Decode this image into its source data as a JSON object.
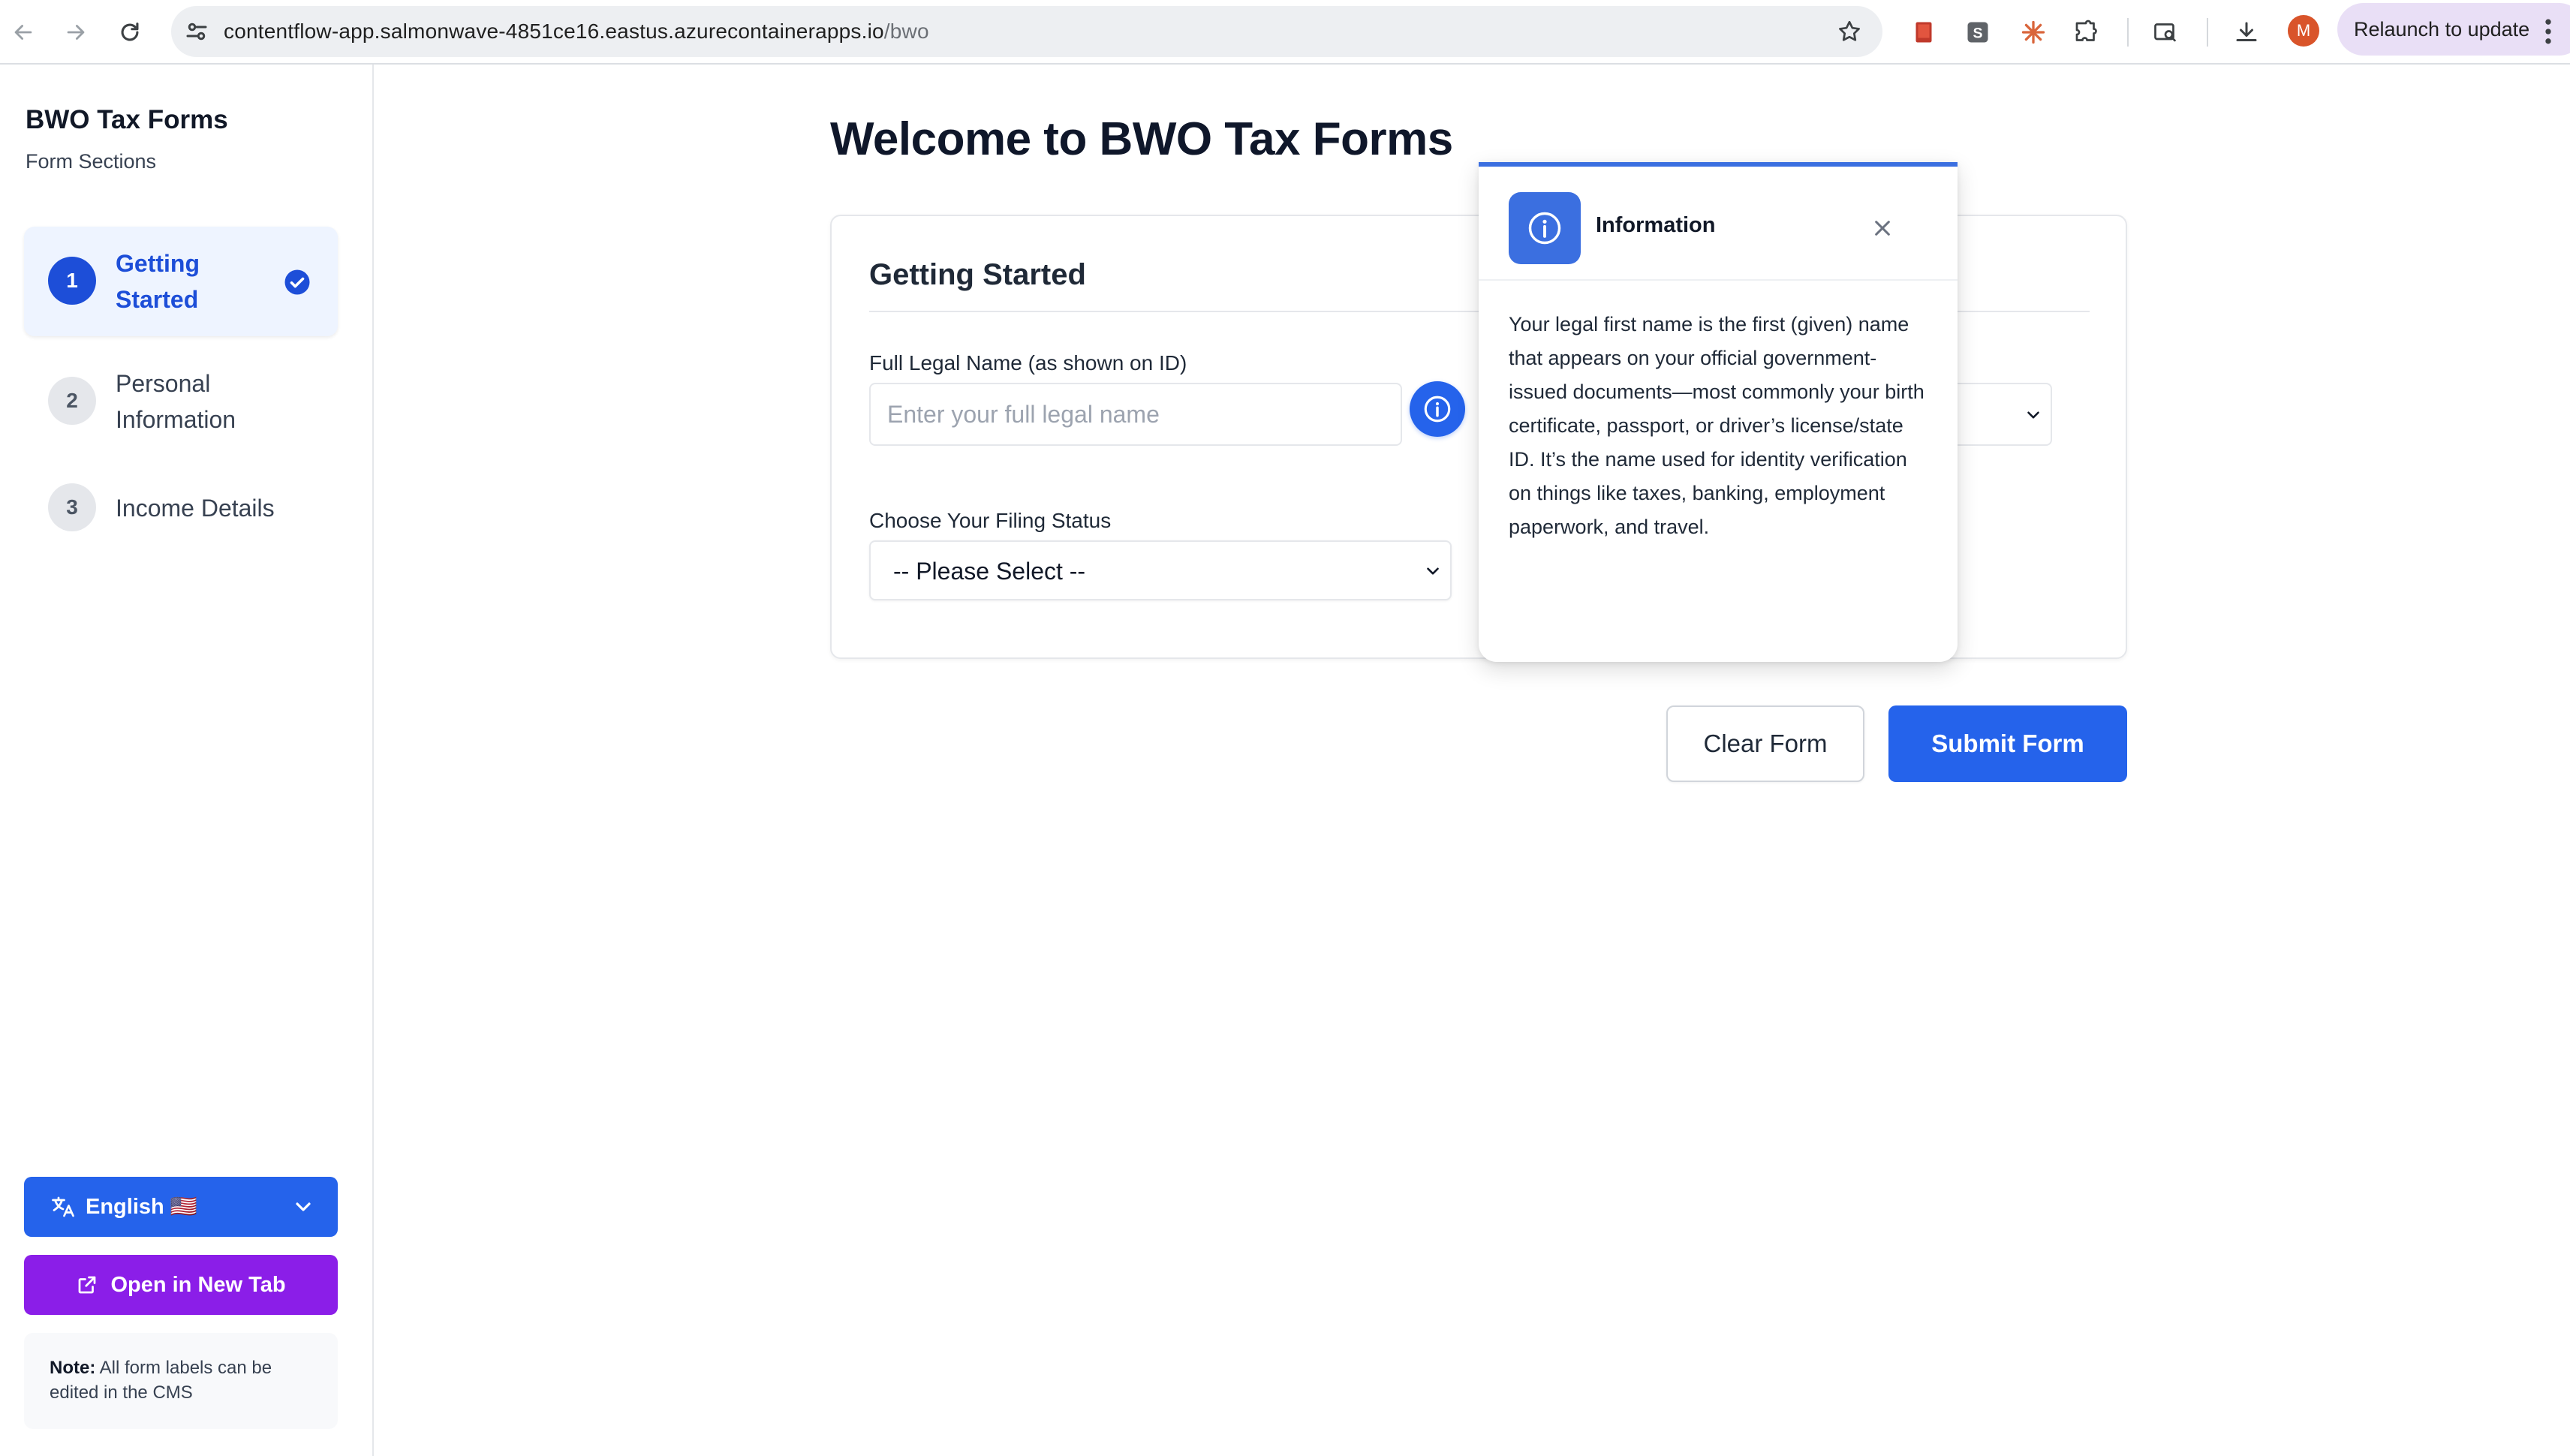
{
  "browser": {
    "url_host": "contentflow-app.salmonwave-4851ce16.eastus.azurecontainerapps.io",
    "url_path": "/bwo",
    "profile_initial": "M",
    "relaunch_label": "Relaunch to update"
  },
  "sidebar": {
    "title": "BWO Tax Forms",
    "subtitle": "Form Sections",
    "steps": [
      {
        "number": "1",
        "label": "Getting Started",
        "state": "active-complete"
      },
      {
        "number": "2",
        "label": "Personal Information",
        "state": "pending"
      },
      {
        "number": "3",
        "label": "Income Details",
        "state": "pending"
      }
    ],
    "language_label": "English 🇺🇸",
    "open_new_tab_label": "Open in New Tab",
    "note_bold": "Note:",
    "note_text": " All form labels can be edited in the CMS"
  },
  "main": {
    "page_title": "Welcome to BWO Tax Forms",
    "section_title": "Getting Started",
    "name_label": "Full Legal Name (as shown on ID)",
    "name_placeholder": "Enter your full legal name",
    "name_value": "",
    "filing_label": "Choose Your Filing Status",
    "filing_value": "-- Please Select --",
    "clear_label": "Clear Form",
    "submit_label": "Submit Form"
  },
  "popover": {
    "title": "Information",
    "body": "Your legal first name is the first (given) name that appears on your official government-issued documents—most commonly your birth certificate, passport, or driver’s license/state ID. It’s the name used for identity verification on things like taxes, banking, employment paperwork, and travel."
  },
  "colors": {
    "accent": "#2563eb",
    "purple_button": "#8b1ee8",
    "popover_icon": "#3b6fe0"
  },
  "icons": {
    "step_complete": "check-circle-icon",
    "info": "info-icon",
    "language": "translate-icon",
    "external": "external-link-icon"
  }
}
